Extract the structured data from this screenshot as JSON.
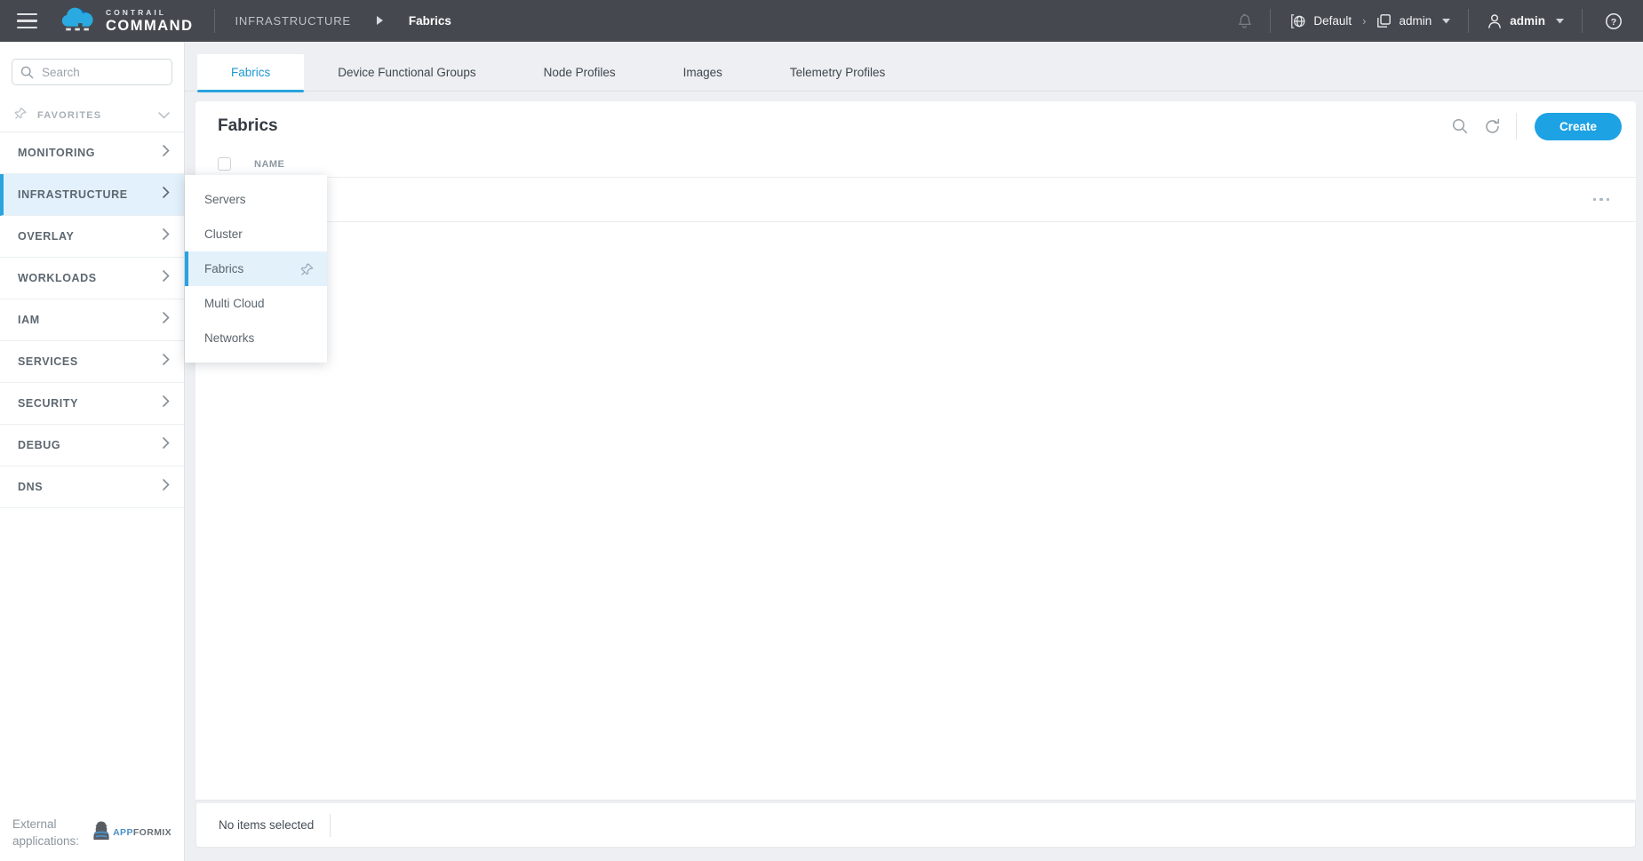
{
  "colors": {
    "accent_blue": "#1da2e4",
    "tab_underline_blue": "#29a3e0",
    "header_bg": "#45494f",
    "active_item_bg": "#e2f1fb",
    "main_bg": "#edeff2",
    "brand_cloud_blue": "#2aaae1"
  },
  "header": {
    "brand_line1": "CONTRAIL",
    "brand_line2": "COMMAND",
    "breadcrumb_section": "INFRASTRUCTURE",
    "breadcrumb_page": "Fabrics",
    "domain_label": "Default",
    "project_label": "admin",
    "user_label": "admin"
  },
  "sidebar": {
    "search_placeholder": "Search",
    "favorites_label": "FAVORITES",
    "items": [
      {
        "label": "MONITORING"
      },
      {
        "label": "INFRASTRUCTURE",
        "active": true
      },
      {
        "label": "OVERLAY"
      },
      {
        "label": "WORKLOADS"
      },
      {
        "label": "IAM"
      },
      {
        "label": "SERVICES"
      },
      {
        "label": "SECURITY"
      },
      {
        "label": "DEBUG"
      },
      {
        "label": "DNS"
      }
    ],
    "external_label": "External\napplications:",
    "external_app_part1": "App",
    "external_app_part2": "Formix"
  },
  "flyout": {
    "items": [
      {
        "label": "Servers"
      },
      {
        "label": "Cluster"
      },
      {
        "label": "Fabrics",
        "active": true,
        "pinned": true
      },
      {
        "label": "Multi Cloud"
      },
      {
        "label": "Networks"
      }
    ]
  },
  "main": {
    "tabs": [
      {
        "label": "Fabrics",
        "active": true
      },
      {
        "label": "Device Functional Groups"
      },
      {
        "label": "Node Profiles"
      },
      {
        "label": "Images"
      },
      {
        "label": "Telemetry Profiles"
      }
    ],
    "page_title": "Fabrics",
    "create_button": "Create",
    "table": {
      "columns": [
        {
          "label": "NAME"
        }
      ]
    },
    "footer_status": "No items selected"
  }
}
